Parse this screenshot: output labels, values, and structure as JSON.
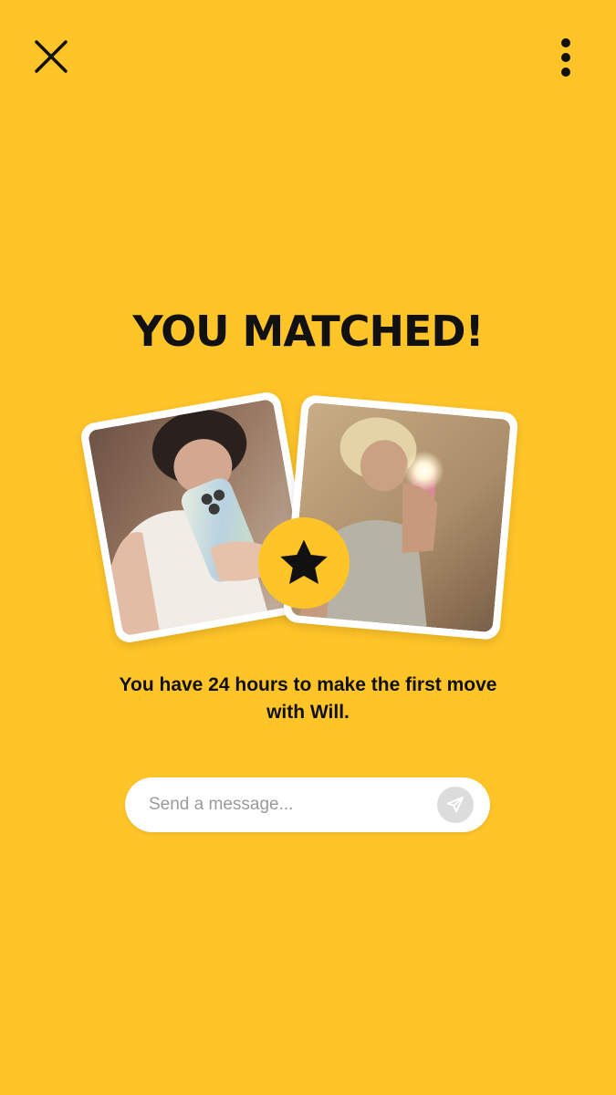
{
  "header": {
    "close_icon": "close-icon",
    "more_icon": "more-vertical-icon"
  },
  "match": {
    "title": "YOU MATCHED!",
    "badge_icon": "star-icon",
    "subtitle": "You have 24 hours to make the first move with Will."
  },
  "message": {
    "placeholder": "Send a message...",
    "send_icon": "send-icon"
  },
  "colors": {
    "background": "#FEC428",
    "text": "#111111",
    "send_button": "#DCDCDC"
  }
}
